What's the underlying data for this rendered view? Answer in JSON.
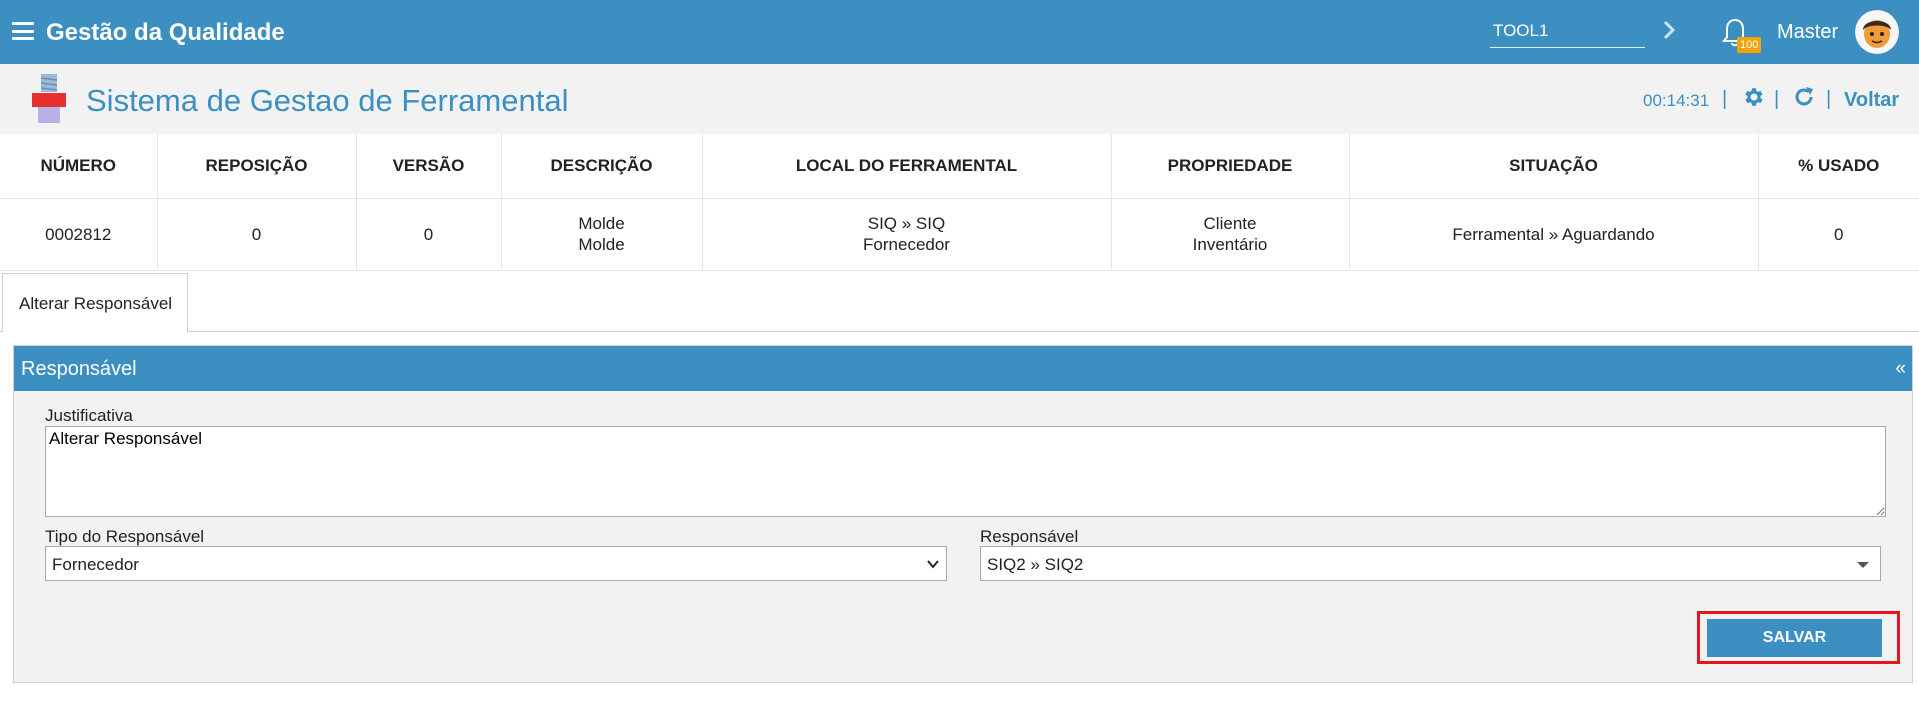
{
  "header": {
    "app_title": "Gestão da Qualidade",
    "search_value": "TOOL1",
    "notification_count": "100",
    "user_name": "Master"
  },
  "subheader": {
    "module_title": "Sistema de Gestao de Ferramental",
    "clock": "00:14:31",
    "separator": "|",
    "back_label": "Voltar"
  },
  "table": {
    "columns": [
      "NÚMERO",
      "REPOSIÇÃO",
      "VERSÃO",
      "DESCRIÇÃO",
      "LOCAL DO FERRAMENTAL",
      "PROPRIEDADE",
      "SITUAÇÃO",
      "% USADO"
    ],
    "row": {
      "numero": "0002812",
      "reposicao": "0",
      "versao": "0",
      "descricao": [
        "Molde",
        "Molde"
      ],
      "local": [
        "SIQ » SIQ",
        "Fornecedor"
      ],
      "propriedade": [
        "Cliente",
        "Inventário"
      ],
      "situacao": "Ferramental » Aguardando",
      "usado": "0"
    }
  },
  "tabs": [
    {
      "label": "Alterar Responsável"
    }
  ],
  "panel": {
    "title": "Responsável",
    "collapse_glyph": "«",
    "justificativa_label": "Justificativa",
    "justificativa_value": "Alterar Responsável",
    "tipo_label": "Tipo do Responsável",
    "tipo_value": "Fornecedor",
    "responsavel_label": "Responsável",
    "responsavel_value": "SIQ2 » SIQ2",
    "save_label": "SALVAR"
  },
  "colors": {
    "primary": "#3b8fc1",
    "highlight": "#e8141e",
    "badge": "#f0a30a"
  },
  "icons": [
    "menu-icon",
    "chevron-right-icon",
    "bell-icon",
    "avatar-icon",
    "tool-module-icon",
    "gear-icon",
    "refresh-icon",
    "chevron-down-icon"
  ]
}
